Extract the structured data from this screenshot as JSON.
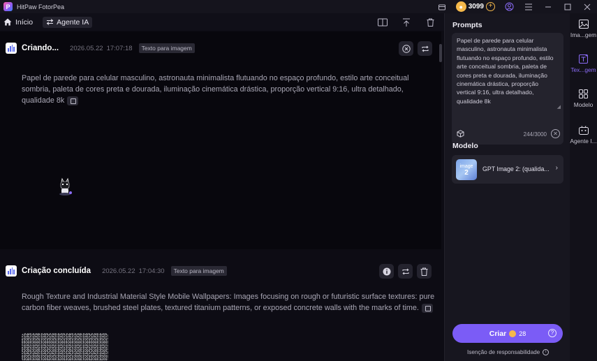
{
  "app": {
    "title": "HitPaw FotorPea",
    "coins": "3099"
  },
  "nav": {
    "home": "Início",
    "agent": "Agente IA"
  },
  "cards": [
    {
      "title": "Criando...",
      "date": "2026.05.22",
      "time": "17:07:18",
      "badge": "Texto para imagem",
      "text": "Papel de parede para celular masculino, astronauta minimalista flutuando no espaço profundo, estilo arte conceitual sombria, paleta de cores preta e dourada, iluminação cinemática drástica, proporção vertical 9:16, ultra detalhado, qualidade 8k"
    },
    {
      "title": "Criação concluída",
      "date": "2026.05.22",
      "time": "17:04:30",
      "badge": "Texto para imagem",
      "text": "Rough Texture and Industrial Material Style Mobile Wallpapers: Images focusing on rough or futuristic surface textures: pure carbon fiber weaves, brushed steel plates, textured titanium patterns, or exposed concrete walls with the marks of time."
    }
  ],
  "panel": {
    "prompts_title": "Prompts",
    "prompt_text": "Papel de parede para celular masculino, astronauta minimalista flutuando no espaço profundo, estilo arte conceitual sombria, paleta de cores preta e dourada, iluminação cinemática drástica, proporção vertical 9:16, ultra detalhado, qualidade 8k",
    "char_count": "244/3000",
    "model_title": "Modelo",
    "model_thumb_line1": "image",
    "model_thumb_line2": "2",
    "model_name": "GPT Image 2: (qualida...",
    "create_label": "Criar",
    "create_cost": "28",
    "disclaimer": "Isenção de responsabilidade"
  },
  "rail": {
    "items": [
      {
        "label": "Ima...gem",
        "icon": "image-icon"
      },
      {
        "label": "Tex...gem",
        "icon": "text-to-image-icon"
      },
      {
        "label": "Modelo",
        "icon": "model-grid-icon"
      },
      {
        "label": "Agente I...",
        "icon": "agent-icon"
      }
    ]
  },
  "colors": {
    "accent": "#7b5cf6",
    "coin": "#f5b84a",
    "background": "#0b0a12"
  }
}
